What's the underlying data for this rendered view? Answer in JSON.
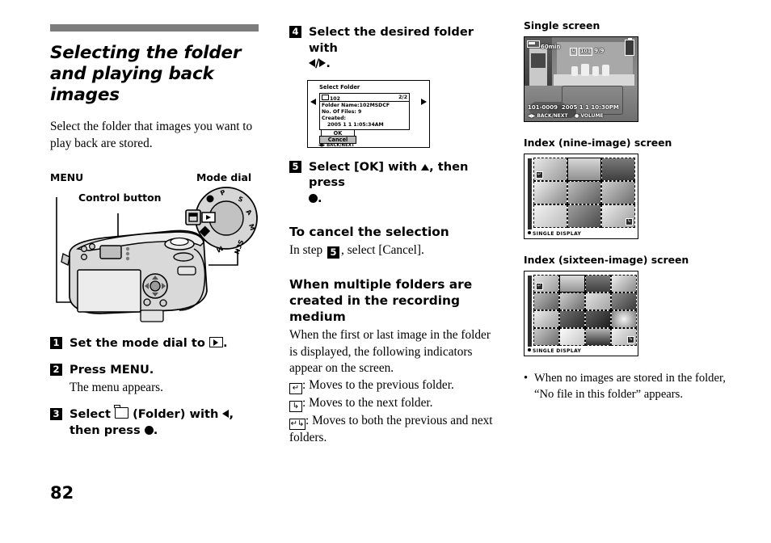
{
  "page": {
    "number": "82",
    "header_rule_color": "#7d7d7d"
  },
  "left": {
    "title": "Selecting the folder and playing back images",
    "lead": "Select the folder that images you want to play back are stored.",
    "diagram": {
      "label_menu": "MENU",
      "label_mode_dial": "Mode dial",
      "label_control_button": "Control button",
      "mode_dial_marks": [
        "P",
        "S",
        "A",
        "M",
        "SCN"
      ]
    },
    "steps": [
      {
        "num": "1",
        "text_before": "Set the mode dial to",
        "icon": "playback-icon",
        "text_after": "."
      },
      {
        "num": "2",
        "text": "Press MENU.",
        "sub": "The menu appears."
      },
      {
        "num": "3",
        "text_before": "Select",
        "icon": "folder-icon",
        "text_mid": "(Folder) with",
        "icon2": "left-arrow-icon",
        "text_after": ", then press",
        "icon3": "center-dot-icon",
        "end": "."
      }
    ]
  },
  "middle": {
    "step4": {
      "num": "4",
      "line1": "Select the desired folder with",
      "line2_icons": "left-right-arrow-icon",
      "line2_end": "."
    },
    "lcd": {
      "title": "Select Folder",
      "folder_number": "102",
      "counter": "2/2",
      "folder_name": "Folder Name:102MSDCF",
      "no_of_files": "No. Of Files:  9",
      "created_label": "Created:",
      "created_value": "2005   1   1   1:05:34AM",
      "ok": "OK",
      "cancel": "Cancel",
      "hint": "BACK/NEXT"
    },
    "step5": {
      "num": "5",
      "line1": "Select [OK] with",
      "icon": "up-arrow-icon",
      "line1_end": ", then press",
      "icon2": "center-dot-icon",
      "line2": "."
    },
    "cancel_heading": "To cancel the selection",
    "cancel_body_before": "In step",
    "cancel_body_num": "5",
    "cancel_body_after": ", select [Cancel].",
    "multi_heading": "When multiple folders are created in the recording medium",
    "multi_body": "When the first or last image in the folder is displayed, the following indicators appear on the screen.",
    "indicators": [
      {
        "icon": "previous-folder-icon",
        "text": ": Moves to the previous folder."
      },
      {
        "icon": "next-folder-icon",
        "text": ": Moves to the next folder."
      },
      {
        "icon": "both-folders-icon",
        "text": ": Moves to both the previous and next folders."
      }
    ]
  },
  "right": {
    "single": {
      "heading": "Single screen",
      "osd_battery": "60min",
      "osd_folder_badge": "101",
      "osd_counter": "9/9",
      "osd_file": "101-0009",
      "osd_datetime": "2005  1  1  10:30PM",
      "osd_hint_back": "BACK/NEXT",
      "osd_hint_volume": "VOLUME"
    },
    "index9": {
      "heading": "Index (nine-image) screen",
      "footer": "SINGLE  DISPLAY",
      "cells": 9,
      "selected_index": 1
    },
    "index16": {
      "heading": "Index (sixteen-image) screen",
      "footer": "SINGLE  DISPLAY",
      "cells": 16,
      "selected_index": 1
    },
    "note": "When no images are stored in the folder, “No file in this folder” appears."
  }
}
